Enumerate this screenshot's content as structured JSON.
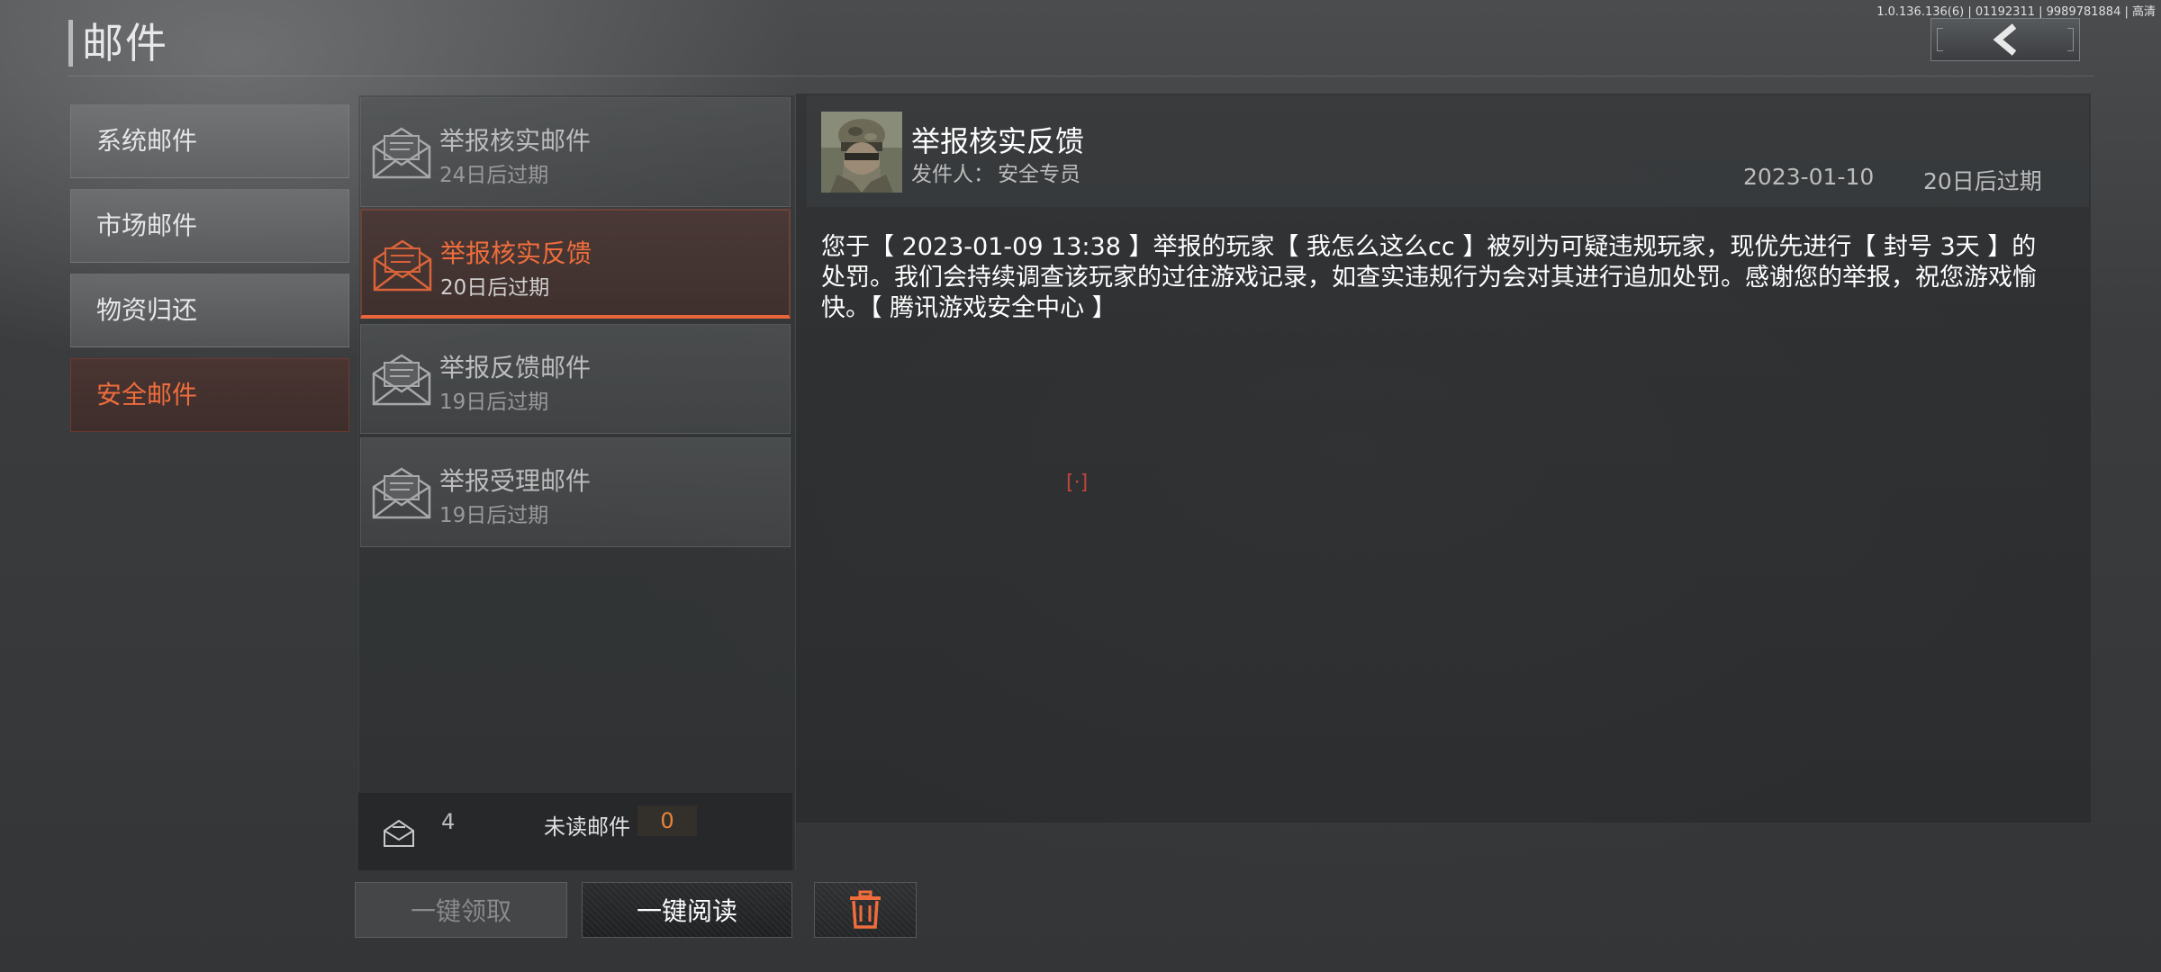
{
  "header": {
    "title": "邮件",
    "version": "1.0.136.136(6) | 01192311 | 9989781884 | 高清",
    "back_icon": "chevron-left-icon"
  },
  "categories": [
    {
      "label": "系统邮件",
      "active": false
    },
    {
      "label": "市场邮件",
      "active": false
    },
    {
      "label": "物资归还",
      "active": false
    },
    {
      "label": "安全邮件",
      "active": true
    }
  ],
  "mails": [
    {
      "title": "举报核实邮件",
      "expire": "24日后过期",
      "icon": "envelope-open-icon",
      "active": false
    },
    {
      "title": "举报核实反馈",
      "expire": "20日后过期",
      "icon": "envelope-open-icon",
      "active": true
    },
    {
      "title": "举报反馈邮件",
      "expire": "19日后过期",
      "icon": "envelope-open-icon",
      "active": false
    },
    {
      "title": "举报受理邮件",
      "expire": "19日后过期",
      "icon": "envelope-open-icon",
      "active": false
    }
  ],
  "summary": {
    "total_count": "4",
    "unread_label": "未读邮件",
    "unread_count": "0"
  },
  "actions": {
    "claim_all": "一键领取",
    "read_all": "一键阅读",
    "delete_icon": "trash-icon"
  },
  "detail": {
    "title": "举报核实反馈",
    "sender_label": "发件人：",
    "sender": "安全专员",
    "date": "2023-01-10",
    "expire": "20日后过期",
    "body": "您于【 2023-01-09 13:38 】举报的玩家【 我怎么这么cc 】被列为可疑违规玩家，现优先进行【 封号 3天 】的处罚。我们会持续调查该玩家的过往游戏记录，如查实违规行为会对其进行追加处罚。感谢您的举报，祝您游戏愉快。【 腾讯游戏安全中心 】",
    "marker": "[·]"
  },
  "colors": {
    "accent": "#ef6d3c",
    "unread": "#e8843a",
    "marker": "#c2443a"
  }
}
